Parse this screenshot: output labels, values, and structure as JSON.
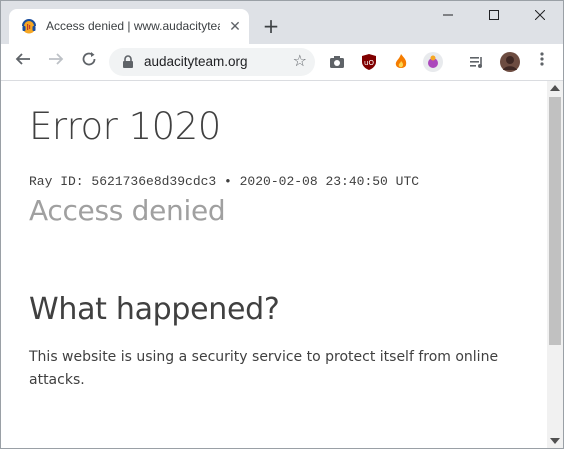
{
  "browser": {
    "tab_title": "Access denied | www.audacityteam.org",
    "tab_close": "✕",
    "new_tab": "+",
    "url": "audacityteam.org",
    "window_controls": {
      "minimize": "—",
      "maximize": "☐",
      "close": "✕"
    }
  },
  "page": {
    "error_title": "Error 1020",
    "ray_line": "Ray ID: 5621736e8d39cdc3 • 2020-02-08 23:40:50 UTC",
    "access_denied": "Access denied",
    "what_happened": "What happened?",
    "description": "This website is using a security service to protect itself from online attacks."
  },
  "extensions": [
    "camera-icon",
    "ublock-icon",
    "fire-icon",
    "bug-icon",
    "media-queue-icon",
    "avatar"
  ],
  "colors": {
    "tabstrip": "#dee1e6",
    "text": "#404040",
    "muted": "#a0a0a0"
  }
}
